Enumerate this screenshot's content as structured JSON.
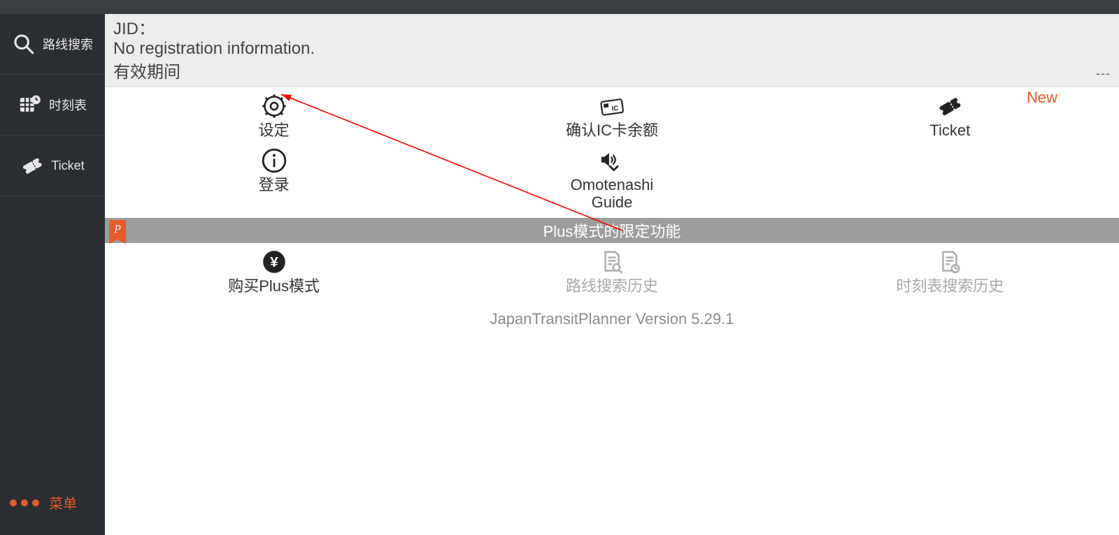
{
  "sidebar": {
    "items": [
      {
        "key": "route-search",
        "label": "路线搜索"
      },
      {
        "key": "timetable",
        "label": "时刻表"
      },
      {
        "key": "ticket",
        "label": "Ticket"
      }
    ],
    "menu_label": "菜单"
  },
  "info": {
    "jid_label": "JID：",
    "registration_text": "No registration information.",
    "validity_label": "有效期间",
    "validity_value": "---"
  },
  "row1": {
    "settings": {
      "label": "设定"
    },
    "ic": {
      "label": "确认IC卡余额"
    },
    "ticket": {
      "label": "Ticket",
      "badge": "New"
    }
  },
  "row2": {
    "login": {
      "label": "登录"
    },
    "omotenashi": {
      "label_line1": "Omotenashi",
      "label_line2": "Guide"
    }
  },
  "plus_bar": {
    "ribbon": "P",
    "title": "Plus模式的限定功能"
  },
  "row3": {
    "buy_plus": {
      "label": "购买Plus模式"
    },
    "route_history": {
      "label": "路线搜索历史"
    },
    "timetable_history": {
      "label": "时刻表搜索历史"
    }
  },
  "version_text": "JapanTransitPlanner Version 5.29.1"
}
